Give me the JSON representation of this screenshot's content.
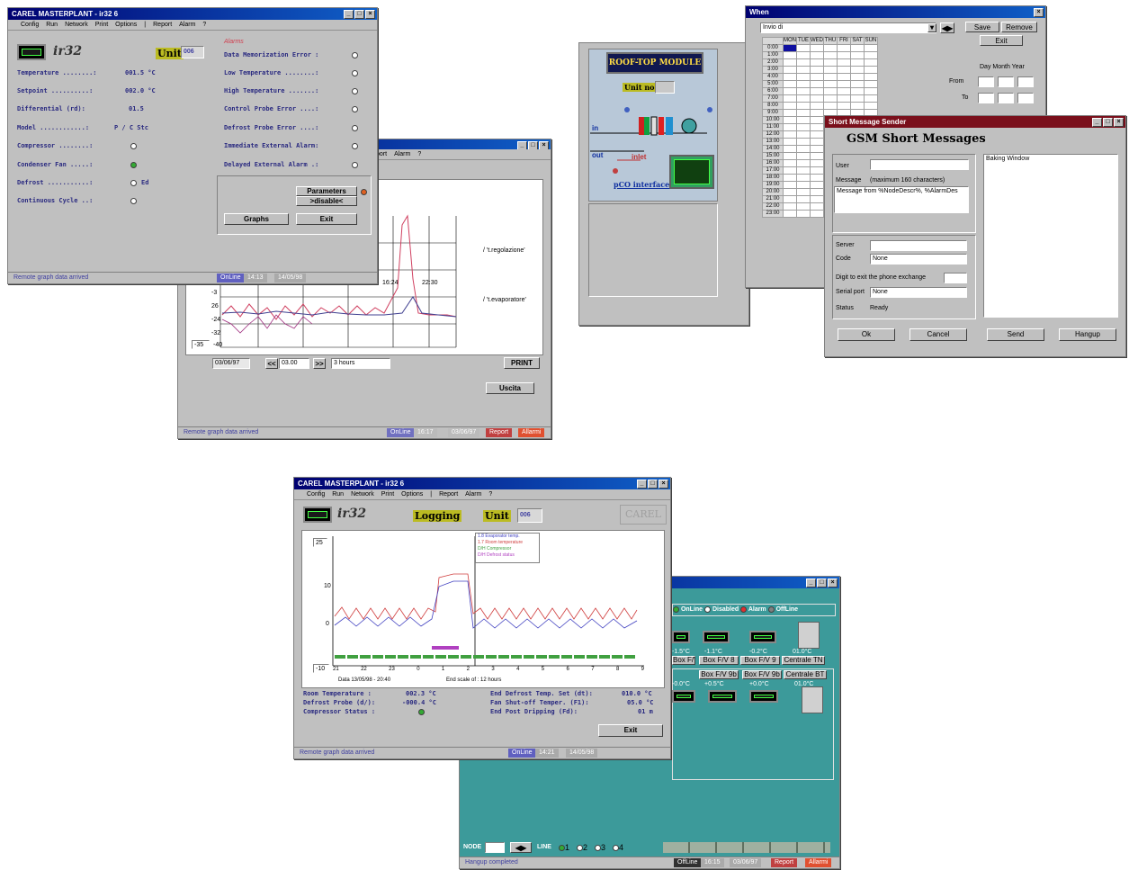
{
  "w1": {
    "title": "CAREL MASTERPLANT - ir32 6",
    "menu": [
      "Config",
      "Run",
      "Network",
      "Print",
      "Options",
      "|",
      "Report",
      "Alarm",
      "?"
    ],
    "brand": "ir32",
    "unit_label": "Unit",
    "unit_value": "006",
    "alarms_heading": "Alarms",
    "left_rows": [
      {
        "label": "Temperature ........:",
        "value": "001.5 °C"
      },
      {
        "label": "Setpoint ..........:",
        "value": "002.0 °C"
      },
      {
        "label": "Differential (rd):",
        "value": "01.5"
      },
      {
        "label": "Model ............:",
        "value": "P / C Stc"
      },
      {
        "label": "Compressor ........:",
        "value": ""
      },
      {
        "label": "Condenser Fan .....:",
        "value": ""
      },
      {
        "label": "Defrost ...........:",
        "value": "Ed"
      },
      {
        "label": "Continuous Cycle ..:",
        "value": ""
      }
    ],
    "alarm_rows": [
      "Data Memorization Error :",
      "Low Temperature ........:",
      "High Temperature .......:",
      "Control Probe Error ....:",
      "Defrost Probe Error ....:",
      "Immediate External Alarm:",
      "Delayed External Alarm .:"
    ],
    "params_btn": "Parameters",
    "disable_btn": ">disable<",
    "graphs_btn": "Graphs",
    "exit_btn": "Exit",
    "status_text": "Remote graph data arrived",
    "online": "OnLine",
    "time": "14:13",
    "date": "14/05/98"
  },
  "w2": {
    "menu": [
      "port",
      "Alarm",
      "?"
    ],
    "legend1": "/ 't.regolazione'",
    "legend2": "/ 't.evaporatore'",
    "y_ticks": [
      "-3",
      "26",
      "-24",
      "-32"
    ],
    "y_min": "-35",
    "y_bottom": "-40",
    "x_ticks": [
      "16:24",
      "22:30"
    ],
    "date_field": "03/06/97",
    "time_field": "03.00",
    "span": "3 hours",
    "print_btn": "PRINT",
    "exit_btn": "Uscita",
    "status_text": "Remote graph data arrived",
    "online": "OnLine",
    "time": "16:17",
    "date": "03/06/97",
    "report": "Report",
    "alarm": "Allarmi"
  },
  "w3": {
    "module_title": "ROOF-TOP MODULE",
    "unit_no": "Unit no.",
    "in": "in",
    "out": "out",
    "inlet": "inlet",
    "pco": "pCO interface"
  },
  "w4": {
    "title": "When",
    "select": "Invio di",
    "save": "Save",
    "remove": "Remove",
    "exit": "Exit",
    "days": [
      "MON",
      "TUE",
      "WED",
      "THU",
      "FRI",
      "SAT",
      "SUN"
    ],
    "hours": [
      "0:00",
      "1:00",
      "2:00",
      "3:00",
      "4:00",
      "5:00",
      "6:00",
      "7:00",
      "8:00",
      "9:00",
      "10:00",
      "11:00",
      "12:00",
      "13:00",
      "14:00",
      "15:00",
      "16:00",
      "17:00",
      "18:00",
      "19:00",
      "20:00",
      "21:00",
      "22:00",
      "23:00"
    ],
    "dmy": "Day  Month  Year",
    "from": "From",
    "to": "To"
  },
  "w5": {
    "title": "Short Message Sender",
    "heading": "GSM Short Messages",
    "user_label": "User",
    "message_label": "Message",
    "message_hint": "(maximum 160 characters)",
    "message_text": "Message from %NodeDescr%, %AlarmDes",
    "side_text": "Baking Window",
    "server_label": "Server",
    "code_label": "Code",
    "code_value": "None",
    "digit_label": "Digit to exit the phone exchange",
    "serial_label": "Serial port",
    "serial_value": "None",
    "status_label": "Status",
    "status_value": "Ready",
    "ok": "Ok",
    "cancel": "Cancel",
    "send": "Send",
    "hangup": "Hangup"
  },
  "w6": {
    "title": "CAREL MASTERPLANT - ir32 6",
    "menu": [
      "Config",
      "Run",
      "Network",
      "Print",
      "Options",
      "|",
      "Report",
      "Alarm",
      "?"
    ],
    "brand": "ir32",
    "logging": "Logging",
    "unit_label": "Unit",
    "unit_value": "006",
    "carel": "CAREL",
    "legend": [
      "1.8 Evaporator temp.",
      "1.7 Room temperature",
      "D/H Compressor",
      "D/H Defrost status"
    ],
    "y_ticks": [
      "25",
      "10",
      "0",
      "-10"
    ],
    "x_ticks": [
      "21",
      "22",
      "23",
      "0",
      "1",
      "2",
      "3",
      "4",
      "5",
      "6",
      "7",
      "8",
      "9"
    ],
    "date_line": "Data  13/05/98  -  20:40",
    "end_scale": "End scale of :  12 hours",
    "rows_left": [
      {
        "label": "Room Temperature  :",
        "value": "002.3 °C"
      },
      {
        "label": "Defrost Probe (d/):",
        "value": "-000.4 °C"
      },
      {
        "label": "Compressor Status :",
        "value": ""
      }
    ],
    "rows_right": [
      {
        "label": "End Defrost Temp. Set (dt):",
        "value": "010.0 °C"
      },
      {
        "label": "Fan Shut-off Temper.  (F1):",
        "value": "05.0 °C"
      },
      {
        "label": "End Post Dripping     (Fd):",
        "value": "01 m"
      }
    ],
    "exit_btn": "Exit",
    "status_text": "Remote graph data arrived",
    "online": "OnLine",
    "time": "14:21",
    "date": "14/05/98"
  },
  "w7": {
    "legend": [
      "OnLine",
      "Disabled",
      "Alarm",
      "OffLine"
    ],
    "temps": [
      "-1.5°C",
      "-1.1°C",
      "-0.2°C",
      "01.0°C"
    ],
    "labels": [
      "Box F/V 7",
      "Box F/V 8",
      "Box F/V 9",
      "Centrale TN"
    ],
    "labels2": [
      "Box F/V 9b",
      "Box F/V 9b",
      "Centrale BT"
    ],
    "temps2": [
      "-0.0°C",
      "+0.5°C",
      "+0.0°C",
      "01.0°C"
    ],
    "node_label": "NODE",
    "line_label": "LINE",
    "lines": [
      "1",
      "2",
      "3",
      "4"
    ],
    "status_text": "Hangup completed",
    "offline": "OffLine",
    "time": "16:15",
    "date": "03/06/97",
    "report": "Report",
    "alarm": "Allarmi"
  }
}
